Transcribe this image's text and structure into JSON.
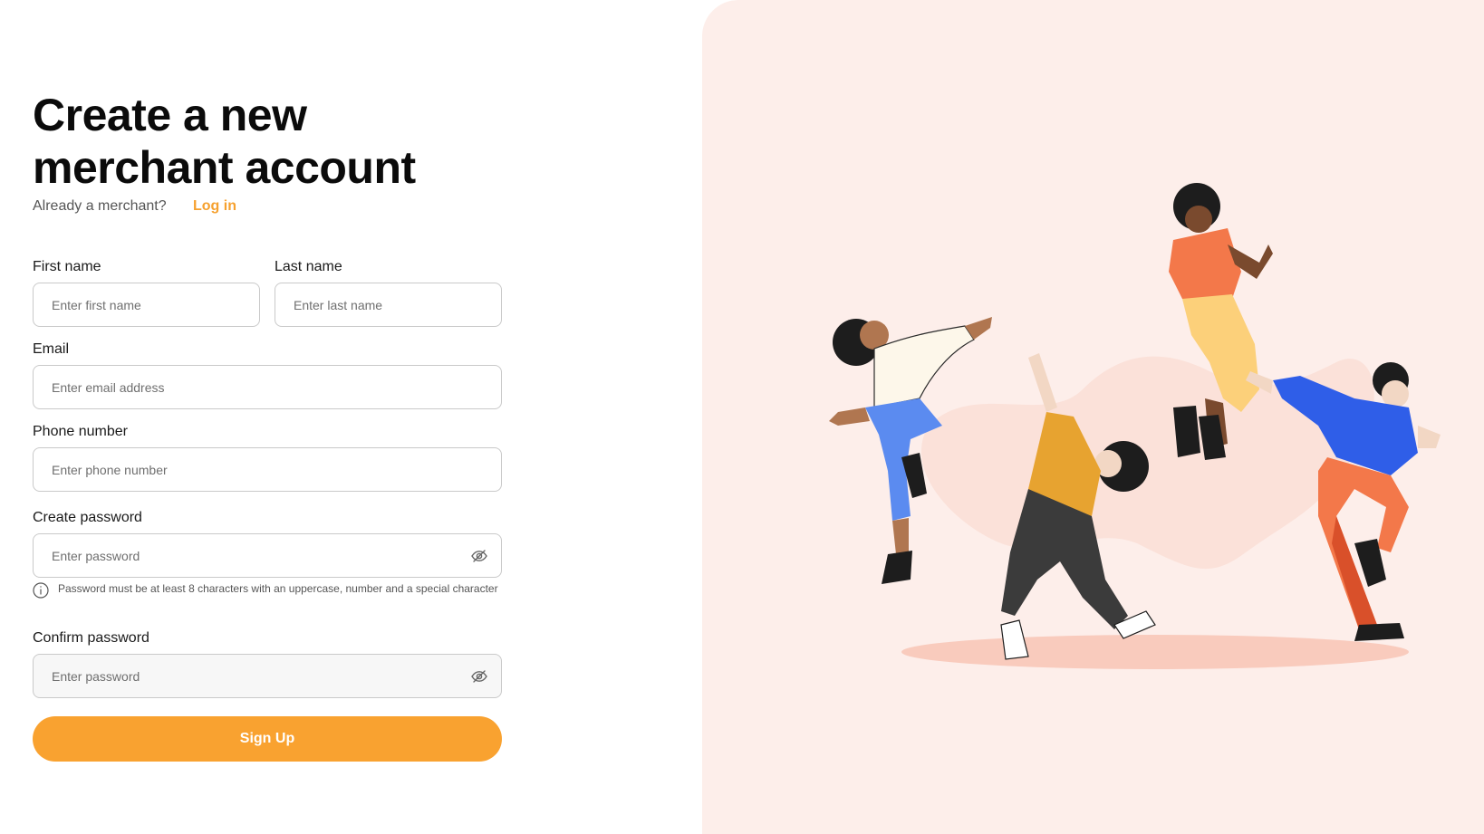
{
  "header": {
    "title_line1": "Create a new",
    "title_line2": "merchant account",
    "already_text": "Already a merchant?",
    "login_link": "Log in"
  },
  "form": {
    "first_name": {
      "label": "First name",
      "placeholder": "Enter first name"
    },
    "last_name": {
      "label": "Last name",
      "placeholder": "Enter last name"
    },
    "email": {
      "label": "Email",
      "placeholder": "Enter email address"
    },
    "phone": {
      "label": "Phone number",
      "placeholder": "Enter phone number"
    },
    "password": {
      "label": "Create password",
      "placeholder": "Enter password"
    },
    "password_hint": "Password must be at least 8 characters with an uppercase, number and a special character",
    "confirm_password": {
      "label": "Confirm password",
      "placeholder": "Enter password"
    },
    "submit_label": "Sign Up"
  },
  "colors": {
    "accent": "#f9a230",
    "link": "#f6a12f",
    "illustration_bg": "#fdeeea"
  },
  "icons": {
    "password_toggle": "eye-off-icon",
    "hint": "info-icon"
  }
}
